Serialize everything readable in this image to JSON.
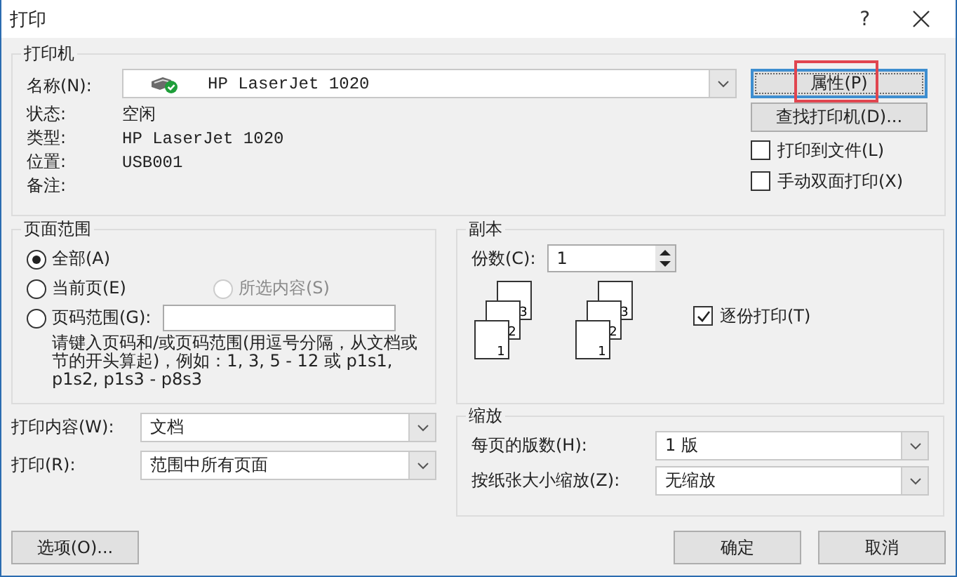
{
  "window": {
    "title": "打印",
    "help": "?"
  },
  "printer": {
    "title": "打印机",
    "name_label": "名称(N):",
    "name_value": "HP LaserJet 1020",
    "fields": [
      {
        "label": "状态:",
        "value": "空闲"
      },
      {
        "label": "类型:",
        "value": "HP LaserJet 1020"
      },
      {
        "label": "位置:",
        "value": "USB001"
      },
      {
        "label": "备注:"
      }
    ],
    "buttons": [
      {
        "label": "属性(P)",
        "focused": true,
        "highlighted": true
      },
      {
        "label": "查找打印机(D)...",
        "focused": false,
        "highlighted": false
      }
    ],
    "options": [
      {
        "label": "打印到文件(L)",
        "checked": false
      },
      {
        "label": "手动双面打印(X)",
        "checked": false
      }
    ]
  },
  "page_range": {
    "title": "页面范围",
    "options": [
      {
        "label": "全部(A)",
        "selected": true,
        "disabled": false
      },
      {
        "label": "当前页(E)",
        "selected": false,
        "disabled": false
      },
      {
        "label": "所选内容(S)",
        "selected": false,
        "disabled": true
      },
      {
        "label": "页码范围(G):",
        "selected": false,
        "disabled": false
      }
    ],
    "hint": "请键入页码和/或页码范围(用逗号分隔，从文档或节的开头算起)，例如：1, 3, 5 - 12 或 p1s1, p1s2, p1s3 - p8s3"
  },
  "copies": {
    "title": "副本",
    "count_label": "份数(C):",
    "count_value": "1",
    "stacks": [
      {
        "pages": [
          "3",
          "2",
          "1"
        ]
      },
      {
        "pages": [
          "3",
          "2",
          "1"
        ]
      }
    ],
    "collate_label": "逐份打印(T)",
    "collate": true
  },
  "print_what": {
    "label": "打印内容(W):",
    "value": "文档"
  },
  "print_pages": {
    "label": "打印(R):",
    "value": "范围中所有页面"
  },
  "zoom": {
    "title": "缩放",
    "per_sheet_label": "每页的版数(H):",
    "per_sheet": "1 版",
    "scale_label": "按纸张大小缩放(Z):",
    "scale": "无缩放"
  },
  "footer": {
    "options": "选项(O)...",
    "ok": "确定",
    "cancel": "取消"
  }
}
